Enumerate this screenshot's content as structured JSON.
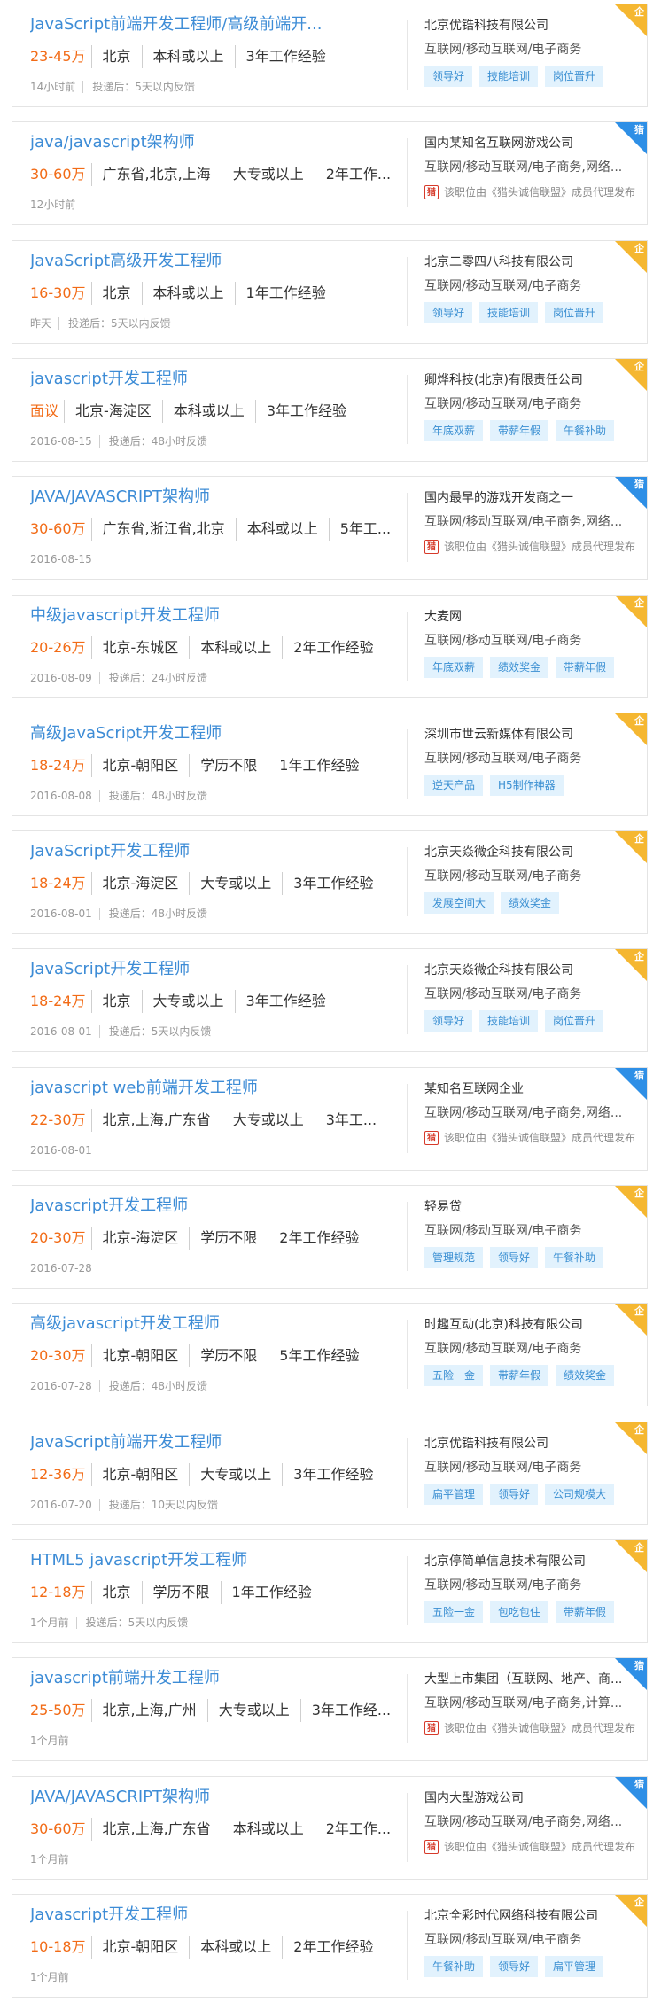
{
  "badges": {
    "enterprise": "企",
    "hunter": "猎"
  },
  "colors": {
    "title": "#3d8cd6",
    "salary": "#f26b16",
    "tag_bg": "#e2f2fd",
    "badge_enterprise": "#f5b731",
    "badge_hunter": "#2e8fe6",
    "hunter_icon": "#d63a2a"
  },
  "jobs": [
    {
      "title": "JavaScript前端开发工程师/高级前端开...",
      "salary": "23-45万",
      "location": "北京",
      "education": "本科或以上",
      "experience": "3年工作经验",
      "time": "14小时前",
      "feedback": "投递后：5天以内反馈",
      "company": "北京优锆科技有限公司",
      "industry": "互联网/移动互联网/电子商务",
      "tags": [
        "领导好",
        "技能培训",
        "岗位晋升"
      ],
      "badge": "企",
      "badge_type": "enterprise",
      "hunter_note": ""
    },
    {
      "title": "java/javascript架构师",
      "salary": "30-60万",
      "location": "广东省,北京,上海",
      "education": "大专或以上",
      "experience": "2年工作...",
      "time": "12小时前",
      "feedback": "",
      "company": "国内某知名互联网游戏公司",
      "industry": "互联网/移动互联网/电子商务,网络...",
      "tags": [],
      "badge": "猎",
      "badge_type": "hunter",
      "hunter_note": "该职位由《猎头诚信联盟》成员代理发布"
    },
    {
      "title": "JavaScript高级开发工程师",
      "salary": "16-30万",
      "location": "北京",
      "education": "本科或以上",
      "experience": "1年工作经验",
      "time": "昨天",
      "feedback": "投递后：5天以内反馈",
      "company": "北京二零四八科技有限公司",
      "industry": "互联网/移动互联网/电子商务",
      "tags": [
        "领导好",
        "技能培训",
        "岗位晋升"
      ],
      "badge": "企",
      "badge_type": "enterprise",
      "hunter_note": ""
    },
    {
      "title": "javascript开发工程师",
      "salary": "面议",
      "location": "北京-海淀区",
      "education": "本科或以上",
      "experience": "3年工作经验",
      "time": "2016-08-15",
      "feedback": "投递后：48小时反馈",
      "company": "卿烨科技(北京)有限责任公司",
      "industry": "互联网/移动互联网/电子商务",
      "tags": [
        "年底双薪",
        "带薪年假",
        "午餐补助"
      ],
      "badge": "企",
      "badge_type": "enterprise",
      "hunter_note": ""
    },
    {
      "title": "JAVA/JAVASCRIPT架构师",
      "salary": "30-60万",
      "location": "广东省,浙江省,北京",
      "education": "本科或以上",
      "experience": "5年工...",
      "time": "2016-08-15",
      "feedback": "",
      "company": "国内最早的游戏开发商之一",
      "industry": "互联网/移动互联网/电子商务,网络...",
      "tags": [],
      "badge": "猎",
      "badge_type": "hunter",
      "hunter_note": "该职位由《猎头诚信联盟》成员代理发布"
    },
    {
      "title": "中级javascript开发工程师",
      "salary": "20-26万",
      "location": "北京-东城区",
      "education": "本科或以上",
      "experience": "2年工作经验",
      "time": "2016-08-09",
      "feedback": "投递后：24小时反馈",
      "company": "大麦网",
      "industry": "互联网/移动互联网/电子商务",
      "tags": [
        "年底双薪",
        "绩效奖金",
        "带薪年假"
      ],
      "badge": "企",
      "badge_type": "enterprise",
      "hunter_note": ""
    },
    {
      "title": "高级JavaScript开发工程师",
      "salary": "18-24万",
      "location": "北京-朝阳区",
      "education": "学历不限",
      "experience": "1年工作经验",
      "time": "2016-08-08",
      "feedback": "投递后：48小时反馈",
      "company": "深圳市世云新媒体有限公司",
      "industry": "互联网/移动互联网/电子商务",
      "tags": [
        "逆天产品",
        "H5制作神器"
      ],
      "badge": "企",
      "badge_type": "enterprise",
      "hunter_note": ""
    },
    {
      "title": "JavaScript开发工程师",
      "salary": "18-24万",
      "location": "北京-海淀区",
      "education": "大专或以上",
      "experience": "3年工作经验",
      "time": "2016-08-01",
      "feedback": "投递后：48小时反馈",
      "company": "北京天焱微企科技有限公司",
      "industry": "互联网/移动互联网/电子商务",
      "tags": [
        "发展空间大",
        "绩效奖金"
      ],
      "badge": "企",
      "badge_type": "enterprise",
      "hunter_note": ""
    },
    {
      "title": "JavaScript开发工程师",
      "salary": "18-24万",
      "location": "北京",
      "education": "大专或以上",
      "experience": "3年工作经验",
      "time": "2016-08-01",
      "feedback": "投递后：5天以内反馈",
      "company": "北京天焱微企科技有限公司",
      "industry": "互联网/移动互联网/电子商务",
      "tags": [
        "领导好",
        "技能培训",
        "岗位晋升"
      ],
      "badge": "企",
      "badge_type": "enterprise",
      "hunter_note": ""
    },
    {
      "title": "javascript web前端开发工程师",
      "salary": "22-30万",
      "location": "北京,上海,广东省",
      "education": "大专或以上",
      "experience": "3年工...",
      "time": "2016-08-01",
      "feedback": "",
      "company": "某知名互联网企业",
      "industry": "互联网/移动互联网/电子商务,网络...",
      "tags": [],
      "badge": "猎",
      "badge_type": "hunter",
      "hunter_note": "该职位由《猎头诚信联盟》成员代理发布"
    },
    {
      "title": "Javascript开发工程师",
      "salary": "20-30万",
      "location": "北京-海淀区",
      "education": "学历不限",
      "experience": "2年工作经验",
      "time": "2016-07-28",
      "feedback": "",
      "company": "轻易贷",
      "industry": "互联网/移动互联网/电子商务",
      "tags": [
        "管理规范",
        "领导好",
        "午餐补助"
      ],
      "badge": "企",
      "badge_type": "enterprise",
      "hunter_note": ""
    },
    {
      "title": "高级javascript开发工程师",
      "salary": "20-30万",
      "location": "北京-朝阳区",
      "education": "学历不限",
      "experience": "5年工作经验",
      "time": "2016-07-28",
      "feedback": "投递后：48小时反馈",
      "company": "时趣互动(北京)科技有限公司",
      "industry": "互联网/移动互联网/电子商务",
      "tags": [
        "五险一金",
        "带薪年假",
        "绩效奖金"
      ],
      "badge": "企",
      "badge_type": "enterprise",
      "hunter_note": ""
    },
    {
      "title": "JavaScript前端开发工程师",
      "salary": "12-36万",
      "location": "北京-朝阳区",
      "education": "大专或以上",
      "experience": "3年工作经验",
      "time": "2016-07-20",
      "feedback": "投递后：10天以内反馈",
      "company": "北京优锆科技有限公司",
      "industry": "互联网/移动互联网/电子商务",
      "tags": [
        "扁平管理",
        "领导好",
        "公司规模大"
      ],
      "badge": "企",
      "badge_type": "enterprise",
      "hunter_note": ""
    },
    {
      "title": "HTML5 javascript开发工程师",
      "salary": "12-18万",
      "location": "北京",
      "education": "学历不限",
      "experience": "1年工作经验",
      "time": "1个月前",
      "feedback": "投递后：5天以内反馈",
      "company": "北京停简单信息技术有限公司",
      "industry": "互联网/移动互联网/电子商务",
      "tags": [
        "五险一金",
        "包吃包住",
        "带薪年假"
      ],
      "badge": "企",
      "badge_type": "enterprise",
      "hunter_note": ""
    },
    {
      "title": "javascript前端开发工程师",
      "salary": "25-50万",
      "location": "北京,上海,广州",
      "education": "大专或以上",
      "experience": "3年工作经...",
      "time": "1个月前",
      "feedback": "",
      "company": "大型上市集团（互联网、地产、商...",
      "industry": "互联网/移动互联网/电子商务,计算...",
      "tags": [],
      "badge": "猎",
      "badge_type": "hunter",
      "hunter_note": "该职位由《猎头诚信联盟》成员代理发布"
    },
    {
      "title": "JAVA/JAVASCRIPT架构师",
      "salary": "30-60万",
      "location": "北京,上海,广东省",
      "education": "本科或以上",
      "experience": "2年工作...",
      "time": "1个月前",
      "feedback": "",
      "company": "国内大型游戏公司",
      "industry": "互联网/移动互联网/电子商务,网络...",
      "tags": [],
      "badge": "猎",
      "badge_type": "hunter",
      "hunter_note": "该职位由《猎头诚信联盟》成员代理发布"
    },
    {
      "title": "Javascript开发工程师",
      "salary": "10-18万",
      "location": "北京-朝阳区",
      "education": "本科或以上",
      "experience": "2年工作经验",
      "time": "1个月前",
      "feedback": "",
      "company": "北京全彩时代网络科技有限公司",
      "industry": "互联网/移动互联网/电子商务",
      "tags": [
        "午餐补助",
        "领导好",
        "扁平管理"
      ],
      "badge": "企",
      "badge_type": "enterprise",
      "hunter_note": ""
    }
  ]
}
